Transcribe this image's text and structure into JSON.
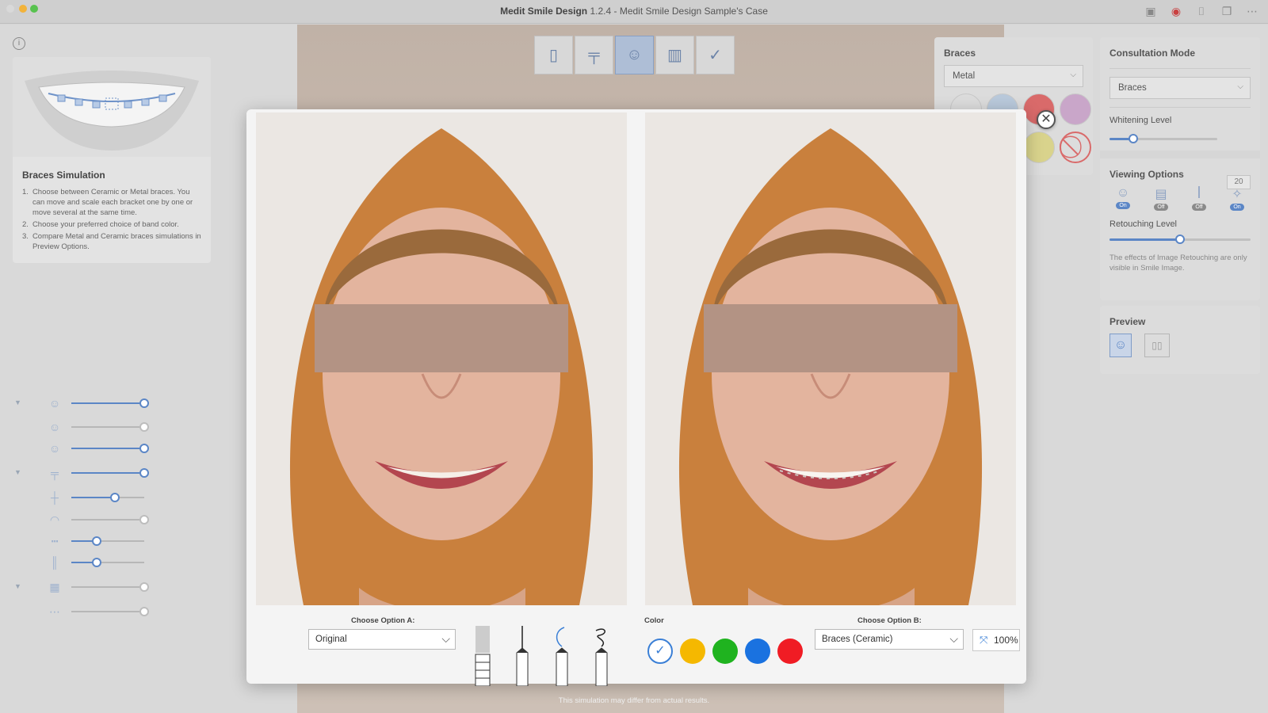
{
  "window": {
    "app_name": "Medit Smile Design",
    "version_and_case": "1.2.4 - Medit Smile Design Sample's Case"
  },
  "titlebar_icons": [
    "screenshot-icon",
    "record-icon",
    "camera-icon",
    "window-icon",
    "more-icon"
  ],
  "help": {
    "title": "Braces Simulation",
    "steps": [
      {
        "n": "1.",
        "text": "Choose between Ceramic or Metal braces. You can move and scale each bracket one by one or move several at the same time."
      },
      {
        "n": "2.",
        "text": "Choose your preferred choice of band color."
      },
      {
        "n": "3.",
        "text": "Compare Metal and Ceramic braces simulations in Preview Options."
      }
    ]
  },
  "left_sliders": [
    {
      "icon": "face-adjust-icon",
      "value": 1.0,
      "active": true,
      "caret": true
    },
    {
      "icon": "face-outline-icon",
      "value": 1.0,
      "active": false,
      "caret": false
    },
    {
      "icon": "face-head-icon",
      "value": 1.0,
      "active": true,
      "caret": false
    },
    {
      "icon": "teeth-midline-icon",
      "value": 1.0,
      "active": true,
      "caret": true
    },
    {
      "icon": "cross-line-icon",
      "value": 0.6,
      "active": true,
      "caret": false
    },
    {
      "icon": "lips-icon",
      "value": 1.0,
      "active": false,
      "caret": false
    },
    {
      "icon": "ruler-icon",
      "value": 0.35,
      "active": true,
      "caret": false
    },
    {
      "icon": "vertical-lines-icon",
      "value": 0.35,
      "active": true,
      "caret": false
    },
    {
      "icon": "teeth-grid-icon",
      "value": 1.0,
      "active": false,
      "caret": true
    },
    {
      "icon": "dots-row-icon",
      "value": 1.0,
      "active": false,
      "caret": false
    }
  ],
  "steps_toolbar": [
    {
      "name": "step-photo",
      "icon": "photo-icon",
      "active": false
    },
    {
      "name": "step-midline",
      "icon": "midline-icon",
      "active": false
    },
    {
      "name": "step-consult",
      "icon": "consult-icon",
      "active": true
    },
    {
      "name": "step-teeth",
      "icon": "teeth-icon",
      "active": false
    },
    {
      "name": "step-check",
      "icon": "clipboard-check-icon",
      "active": false
    }
  ],
  "braces_panel": {
    "title": "Braces",
    "type_value": "Metal",
    "swatch_colors": [
      "#dcdcdc",
      "#b9c9db",
      "#d96a6a",
      "#c9a6c9",
      "#d9d38c"
    ]
  },
  "consult_panel": {
    "title": "Consultation Mode",
    "mode_value": "Braces",
    "whitening_label": "Whitening Level",
    "whitening_value": "20",
    "whitening_fraction": 0.22,
    "viewing_title": "Viewing Options",
    "viewing_options": [
      {
        "icon": "face-hat-icon",
        "state": "On"
      },
      {
        "icon": "frame-icon",
        "state": "Off"
      },
      {
        "icon": "teeth-row-icon",
        "state": "Off"
      },
      {
        "icon": "sparkle-face-icon",
        "state": "On"
      }
    ],
    "retouch_label": "Retouching Level",
    "retouch_fraction": 0.5,
    "retouch_note": "The effects of Image Retouching are only visible in Smile Image."
  },
  "preview_panel": {
    "title": "Preview"
  },
  "modal": {
    "option_a_label": "Choose Option A:",
    "option_a_value": "Original",
    "color_label": "Color",
    "colors": [
      "#ffffff",
      "#f5b800",
      "#1fb31f",
      "#1a72e0",
      "#f01c24"
    ],
    "option_b_label": "Choose Option B:",
    "option_b_value": "Braces (Ceramic)",
    "zoom_value": "100%"
  },
  "disclaimer": "This simulation may differ from actual results."
}
